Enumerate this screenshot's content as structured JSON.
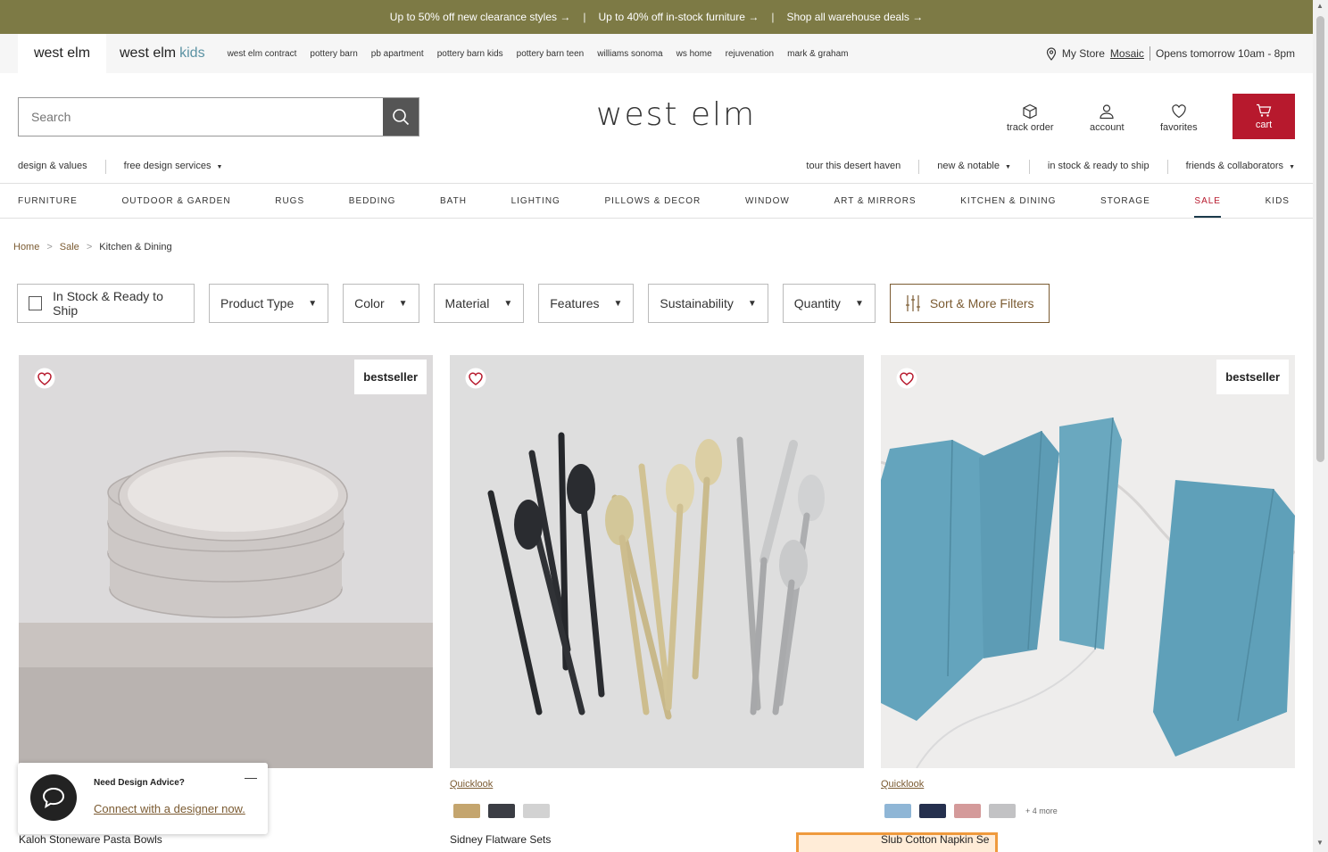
{
  "promo": [
    "Up to 50% off new clearance styles →",
    "Up to 40% off in-stock furniture →",
    "Shop all warehouse deals →"
  ],
  "brands": {
    "active": "west elm",
    "kids_a": "west elm",
    "kids_b": "kids"
  },
  "sister_sites": [
    "west elm contract",
    "pottery barn",
    "pb apartment",
    "pottery barn kids",
    "pottery barn teen",
    "williams sonoma",
    "ws home",
    "rejuvenation",
    "mark & graham"
  ],
  "store": {
    "label": "My Store",
    "name": "Mosaic",
    "hours": "Opens tomorrow 10am - 8pm"
  },
  "search": {
    "placeholder": "Search"
  },
  "logo": "west elm",
  "util": {
    "track": "track order",
    "account": "account",
    "favorites": "favorites",
    "cart": "cart"
  },
  "subnav": {
    "left": [
      "design & values",
      "free design services"
    ],
    "right": [
      "tour this desert haven",
      "new & notable",
      "in stock & ready to ship",
      "friends & collaborators"
    ]
  },
  "mainnav": [
    "FURNITURE",
    "OUTDOOR & GARDEN",
    "RUGS",
    "BEDDING",
    "BATH",
    "LIGHTING",
    "PILLOWS & DECOR",
    "WINDOW",
    "ART & MIRRORS",
    "KITCHEN & DINING",
    "STORAGE",
    "SALE",
    "KIDS"
  ],
  "breadcrumb": [
    "Home",
    ">",
    "Sale",
    ">",
    "Kitchen & Dining"
  ],
  "filters": {
    "instock": "In Stock & Ready to Ship",
    "items": [
      "Product Type",
      "Color",
      "Material",
      "Features",
      "Sustainability",
      "Quantity"
    ],
    "sort": "Sort & More Filters"
  },
  "products": [
    {
      "name": "Kaloh Stoneware Pasta Bowls",
      "badge": "bestseller",
      "quicklook": "",
      "swatches": [],
      "more": ""
    },
    {
      "name": "Sidney Flatware Sets",
      "badge": "",
      "quicklook": "Quicklook",
      "swatches": [
        "#c4a56e",
        "#3b3d44",
        "#d2d2d2"
      ],
      "more": ""
    },
    {
      "name": "Slub Cotton Napkin Se",
      "badge": "bestseller",
      "quicklook": "Quicklook",
      "swatches": [
        "#8fb6d6",
        "#25304e",
        "#d49a9a",
        "#c2c2c4"
      ],
      "more": "+ 4 more"
    }
  ],
  "chat": {
    "title": "Need Design Advice?",
    "link": "Connect with a designer now.",
    "close": "—"
  },
  "colors": {
    "promo": "#7d7a45",
    "cart": "#b7192d",
    "accent": "#7b5b32"
  }
}
